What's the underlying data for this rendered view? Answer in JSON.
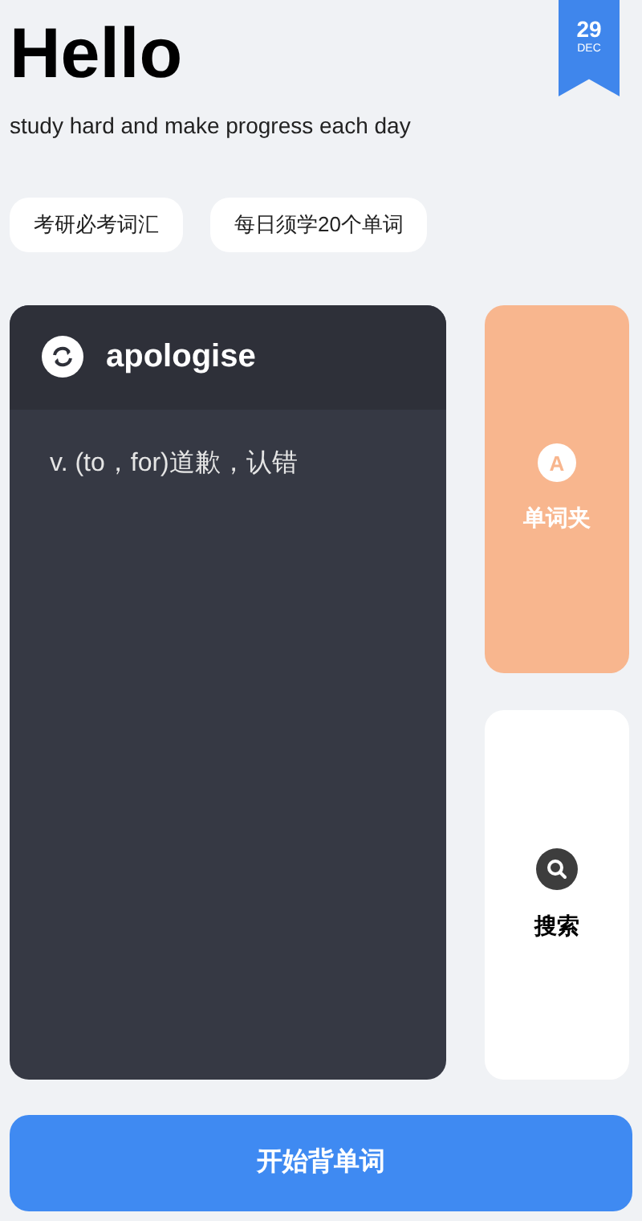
{
  "header": {
    "title": "Hello",
    "subtitle": "study hard and make progress each day",
    "date": {
      "day": "29",
      "month": "DEC"
    }
  },
  "tags": [
    "考研必考词汇",
    "每日须学20个单词"
  ],
  "word_card": {
    "word": "apologise",
    "definition": "v. (to，for)道歉，认错"
  },
  "side_cards": [
    {
      "kind": "letter",
      "icon_text": "A",
      "label": "单词夹"
    },
    {
      "kind": "search",
      "label": "搜索"
    }
  ],
  "start_button": "开始背单词"
}
